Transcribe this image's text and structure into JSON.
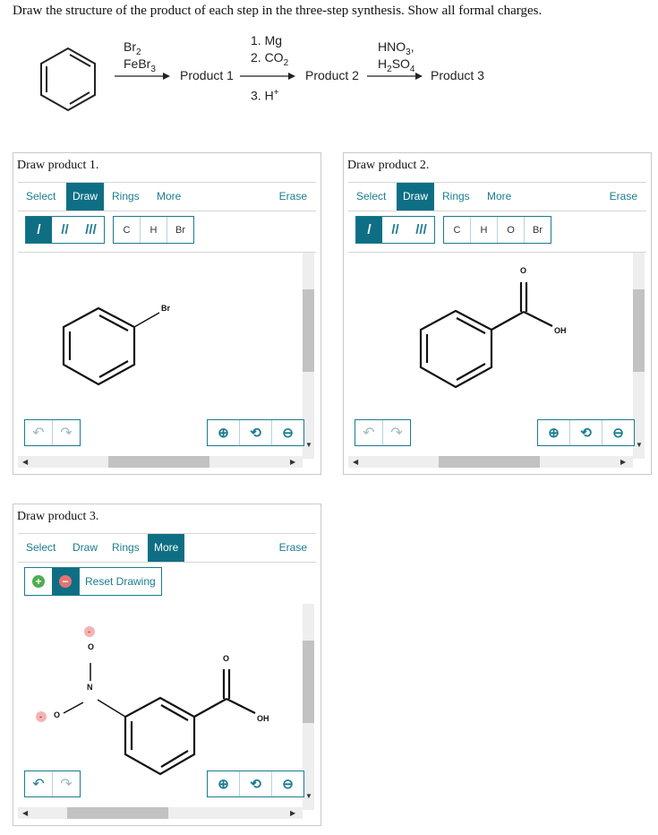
{
  "instruction": "Draw the structure of the product of each step in the three-step synthesis. Show all formal charges.",
  "scheme": {
    "reagent1_line1": "Br2",
    "reagent1_line2": "FeBr3",
    "product1": "Product 1",
    "reagent2_line1": "1. Mg",
    "reagent2_line2": "2. CO2",
    "reagent2_line3": "3. H+",
    "product2": "Product 2",
    "reagent3_line1": "HNO3,",
    "reagent3_line2": "H2SO4",
    "product3": "Product 3"
  },
  "panels": [
    {
      "title": "Draw product 1.",
      "tabs": [
        "Select",
        "Draw",
        "Rings",
        "More"
      ],
      "active_tab": "Draw",
      "erase": "Erase",
      "atoms": [
        "C",
        "H",
        "Br"
      ],
      "atom_labels": {
        "br": "Br"
      }
    },
    {
      "title": "Draw product 2.",
      "tabs": [
        "Select",
        "Draw",
        "Rings",
        "More"
      ],
      "active_tab": "Draw",
      "erase": "Erase",
      "atoms": [
        "C",
        "H",
        "O",
        "Br"
      ],
      "atom_labels": {
        "o": "O",
        "oh": "OH"
      }
    },
    {
      "title": "Draw product 3.",
      "tabs": [
        "Select",
        "Draw",
        "Rings",
        "More"
      ],
      "active_tab": "More",
      "erase": "Erase",
      "reset_label": "Reset Drawing",
      "atom_labels": {
        "o_top": "O",
        "n": "N",
        "o_left": "O",
        "o_carbonyl": "O",
        "oh": "OH",
        "minus": "-"
      }
    }
  ],
  "colors": {
    "accent": "#0e6f84",
    "link": "#1b7c8f",
    "plus_green": "#4caf50",
    "minus_red": "#e57373"
  }
}
